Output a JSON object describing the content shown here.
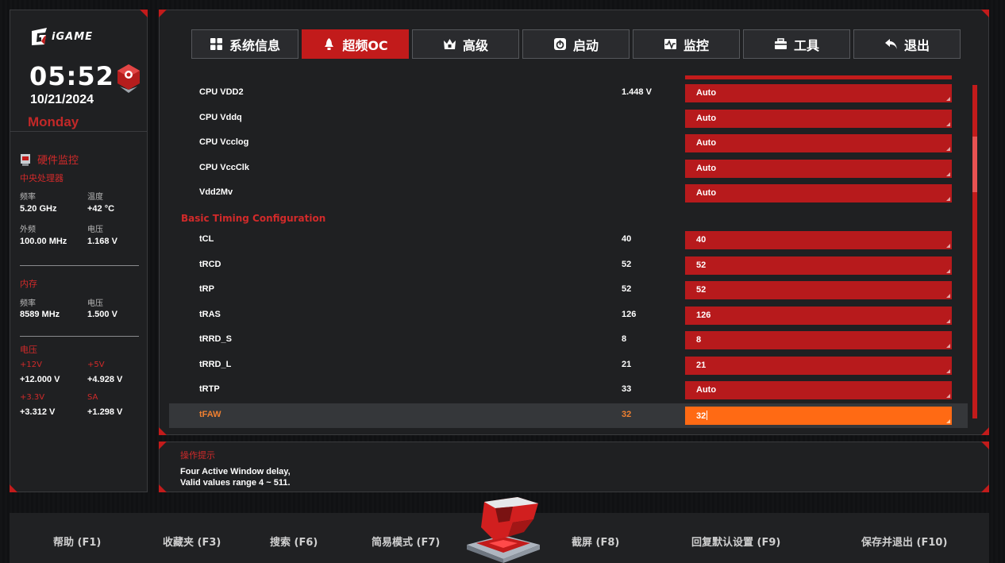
{
  "left": {
    "logo_text": "iGAME",
    "time": "05:52",
    "date": "10/21/2024",
    "weekday": "Monday",
    "hw_monitor_title": "硬件监控",
    "cpu": {
      "title": "中央处理器",
      "freq_label": "频率",
      "freq_value": "5.20 GHz",
      "temp_label": "温度",
      "temp_value": "+42 °C",
      "bclk_label": "外频",
      "bclk_value": "100.00 MHz",
      "volt_label": "电压",
      "volt_value": "1.168 V"
    },
    "memory": {
      "title": "内存",
      "freq_label": "频率",
      "freq_value": "8589 MHz",
      "volt_label": "电压",
      "volt_value": "1.500 V"
    },
    "voltage": {
      "title": "电压",
      "v12_label": "+12V",
      "v12_value": "+12.000 V",
      "v5_label": "+5V",
      "v5_value": "+4.928 V",
      "v33_label": "+3.3V",
      "v33_value": "+3.312 V",
      "sa_label": "SA",
      "sa_value": "+1.298 V"
    }
  },
  "tabs": [
    {
      "label": "系统信息",
      "icon": "grid-icon"
    },
    {
      "label": "超频OC",
      "icon": "rocket-icon",
      "active": true
    },
    {
      "label": "高级",
      "icon": "crown-icon"
    },
    {
      "label": "启动",
      "icon": "power-icon"
    },
    {
      "label": "监控",
      "icon": "pulse-icon"
    },
    {
      "label": "工具",
      "icon": "toolbox-icon"
    },
    {
      "label": "退出",
      "icon": "back-arrow-icon"
    }
  ],
  "settings": {
    "rows_top": [
      {
        "name": "CPU VDD2",
        "current": "1.448 V",
        "value": "Auto"
      },
      {
        "name": "CPU Vddq",
        "current": "",
        "value": "Auto"
      },
      {
        "name": "CPU Vcclog",
        "current": "",
        "value": "Auto"
      },
      {
        "name": "CPU VccClk",
        "current": "",
        "value": "Auto"
      },
      {
        "name": "Vdd2Mv",
        "current": "",
        "value": "Auto"
      }
    ],
    "section_heading": "Basic Timing Configuration",
    "rows_timing": [
      {
        "name": "tCL",
        "current": "40",
        "value": "40"
      },
      {
        "name": "tRCD",
        "current": "52",
        "value": "52"
      },
      {
        "name": "tRP",
        "current": "52",
        "value": "52"
      },
      {
        "name": "tRAS",
        "current": "126",
        "value": "126"
      },
      {
        "name": "tRRD_S",
        "current": "8",
        "value": "8"
      },
      {
        "name": "tRRD_L",
        "current": "21",
        "value": "21"
      },
      {
        "name": "tRTP",
        "current": "33",
        "value": "Auto"
      }
    ],
    "selected_row": {
      "name": "tFAW",
      "current": "32",
      "value": "32"
    }
  },
  "hint": {
    "title": "操作提示",
    "line1": "Four Active Window delay,",
    "line2": "Valid values range 4 ~ 511."
  },
  "bottom": {
    "help": "帮助 (F1)",
    "favorites": "收藏夹 (F3)",
    "search": "搜索 (F6)",
    "easy_mode": "简易模式 (F7)",
    "screenshot": "截屏 (F8)",
    "restore_defaults": "回复默认设置 (F9)",
    "save_exit": "保存并退出 (F10)"
  },
  "colors": {
    "accent": "#c21b1b",
    "selected": "#ff6a14",
    "panel": "#1f2022"
  }
}
